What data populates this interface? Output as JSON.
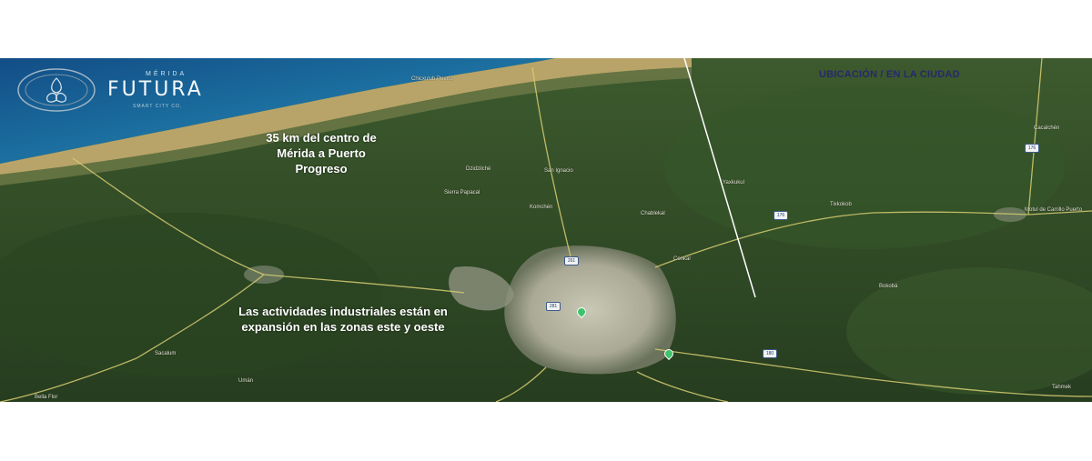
{
  "logo": {
    "top": "MÉRIDA",
    "name": "FUTURA",
    "tagline": "SMART CITY CO."
  },
  "section_label": "UBICACIÓN / EN LA CIUDAD",
  "annotations": {
    "distance": "35 km del centro de Mérida a Puerto Progreso",
    "industry": "Las actividades industriales están en expansión en las zonas este y oeste"
  },
  "places": [
    "Chicxulub Puerto",
    "Dzidzilché",
    "San Ignacio",
    "Sierra Papacal",
    "Komchén",
    "Conkal",
    "Chablekal",
    "Motul de Carrillo Puerto",
    "Cacalchén",
    "Bokobá",
    "Tahmek",
    "Bella Flor",
    "Umán",
    "Tixkokob",
    "Sacalum",
    "Yaxkukul"
  ],
  "route_shields": [
    "261",
    "176",
    "176",
    "180",
    "281"
  ],
  "colors": {
    "sea": "#1e6fa1",
    "vegetation": "#2f4a26",
    "city": "#b9b8a8",
    "label_blue": "#26296b"
  }
}
